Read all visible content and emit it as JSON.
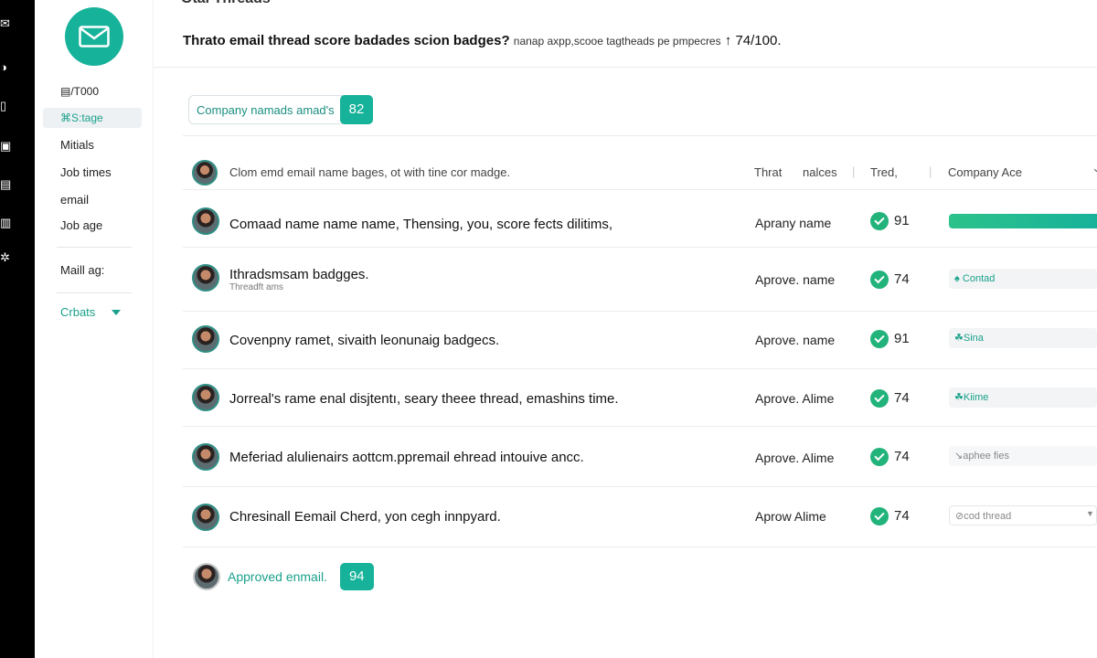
{
  "app": {
    "header_cut_title": "Otal Threads",
    "description_bold": "Thrato email thread score badades scion badges?",
    "description_small": "nanap axpp,scooe tagtheads pe pmpecres",
    "description_ratio": "74/100."
  },
  "sidebar": {
    "counter": "▤/T000",
    "items": [
      {
        "label": "⌘S:tage"
      },
      {
        "label": "Mitials"
      },
      {
        "label": "Job times"
      },
      {
        "label": "email"
      },
      {
        "label": "Job age"
      }
    ],
    "section_label": "Maill ag:",
    "select_value": "Crbats"
  },
  "filter_chip": {
    "label": "Company namads amad's",
    "score": "82"
  },
  "table": {
    "headers": {
      "subject": "Clom emd email name bages, ot with tine cor madge.",
      "threat": "Thrat",
      "values": "nalces",
      "tred": "Tred,",
      "company": "Company Ace"
    },
    "rows": [
      {
        "title": "Comaad name name name, Thensing, you, score fects dilitims,",
        "subtitle": "",
        "name": "Aprany  name",
        "score": "91",
        "tag": ""
      },
      {
        "title": "Ithradsmsam badgges.",
        "subtitle": "Threadft ams",
        "name": "Aprove. name",
        "score": "74",
        "tag": "♠ Contad"
      },
      {
        "title": "Covenpny ramet, sivaith leonunaig badgecs.",
        "subtitle": "",
        "name": "Aprove. name",
        "score": "91",
        "tag": "☘Sina"
      },
      {
        "title": "Jorreal's rame enal disjtentı, seary theee thread, emashins time.",
        "subtitle": "",
        "name": "Aprove. Alime",
        "score": "74",
        "tag": "☘Kiime"
      },
      {
        "title": "Meferiad alulienairs aottcm.ppremail ehread intouive ancc.",
        "subtitle": "",
        "name": "Aprove. Alime",
        "score": "74",
        "tag": "↘aphee fies"
      },
      {
        "title": "Chresinall Eemail Cherd, yon cegh innpyard.",
        "subtitle": "",
        "name": "Aprow  Alime",
        "score": "74",
        "tag": "⊘cod thread"
      }
    ]
  },
  "approved": {
    "label": "Approved enmail.",
    "score": "94"
  },
  "colors": {
    "accent": "#17b29a",
    "success": "#22b37b",
    "rail": "#000000"
  }
}
